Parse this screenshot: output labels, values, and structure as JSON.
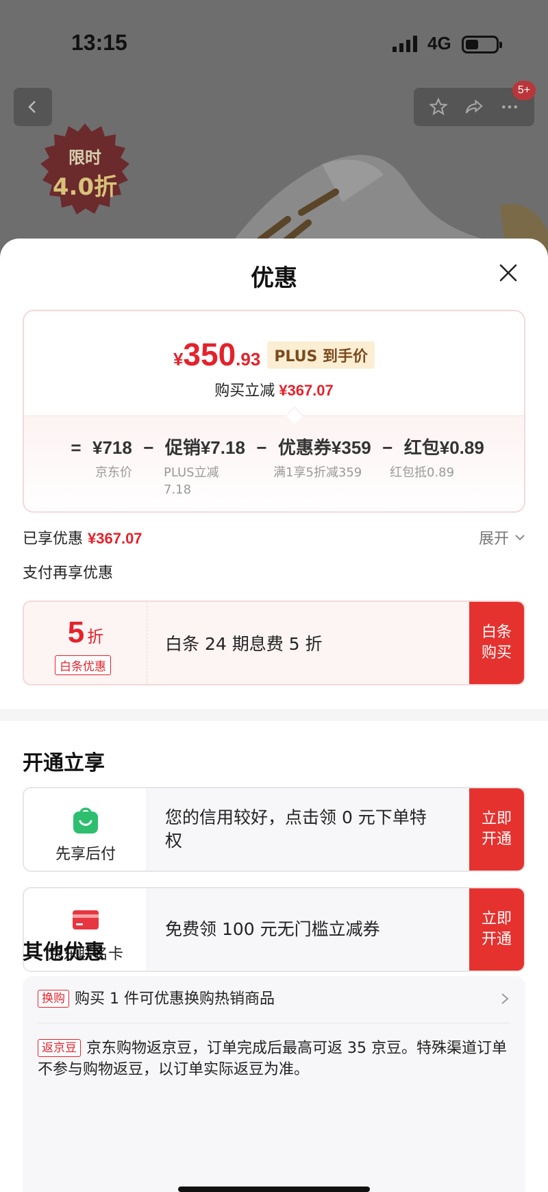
{
  "status_bar": {
    "time": "13:15",
    "network": "4G"
  },
  "header": {
    "badge": "5+"
  },
  "promo": {
    "line1": "限时",
    "line2": "4.0折"
  },
  "sheet": {
    "title": "优惠",
    "price": {
      "currency": "¥",
      "integer": "350",
      "decimal": ".93",
      "tag": "PLUS 到手价"
    },
    "reduce": {
      "label": "购买立减",
      "value": "¥367.07"
    },
    "formula": {
      "eq": "=",
      "items": [
        {
          "value": "¥718",
          "sub": "京东价"
        },
        {
          "value": "促销¥7.18",
          "sub": "PLUS立减\n7.18"
        },
        {
          "value": "优惠券¥359",
          "sub": "满1享5折减359"
        },
        {
          "value": "红包¥0.89",
          "sub": "红包抵0.89"
        }
      ],
      "op": "−"
    },
    "enjoyed": {
      "label": "已享优惠",
      "value": "¥367.07",
      "expand": "展开"
    },
    "pay_label": "支付再享优惠",
    "pay_card": {
      "discount_num": "5",
      "discount_unit": "折",
      "tag": "白条优惠",
      "desc": "白条 24 期息费 5 折",
      "action": "白条购买"
    },
    "open_title": "开通立享",
    "open_cards": [
      {
        "label": "先享后付",
        "desc": "您的信用较好，点击领 0 元下单特权",
        "action": "立即开通"
      },
      {
        "label": "京东联名卡",
        "desc": "免费领 100 元无门槛立减券",
        "action": "立即开通"
      }
    ],
    "other_title": "其他优惠",
    "other_rows": [
      {
        "tag": "换购",
        "text": "购买 1 件可优惠换购热销商品"
      },
      {
        "tag": "返京豆",
        "text": "京东购物返京豆，订单完成后最高可返 35 京豆。特殊渠道订单不参与购物返豆，以订单实际返豆为准。"
      }
    ]
  },
  "colors": {
    "accent": "#e5222b",
    "action_bg": "#e5322f",
    "plus_tag_bg": "#fbeed3"
  }
}
